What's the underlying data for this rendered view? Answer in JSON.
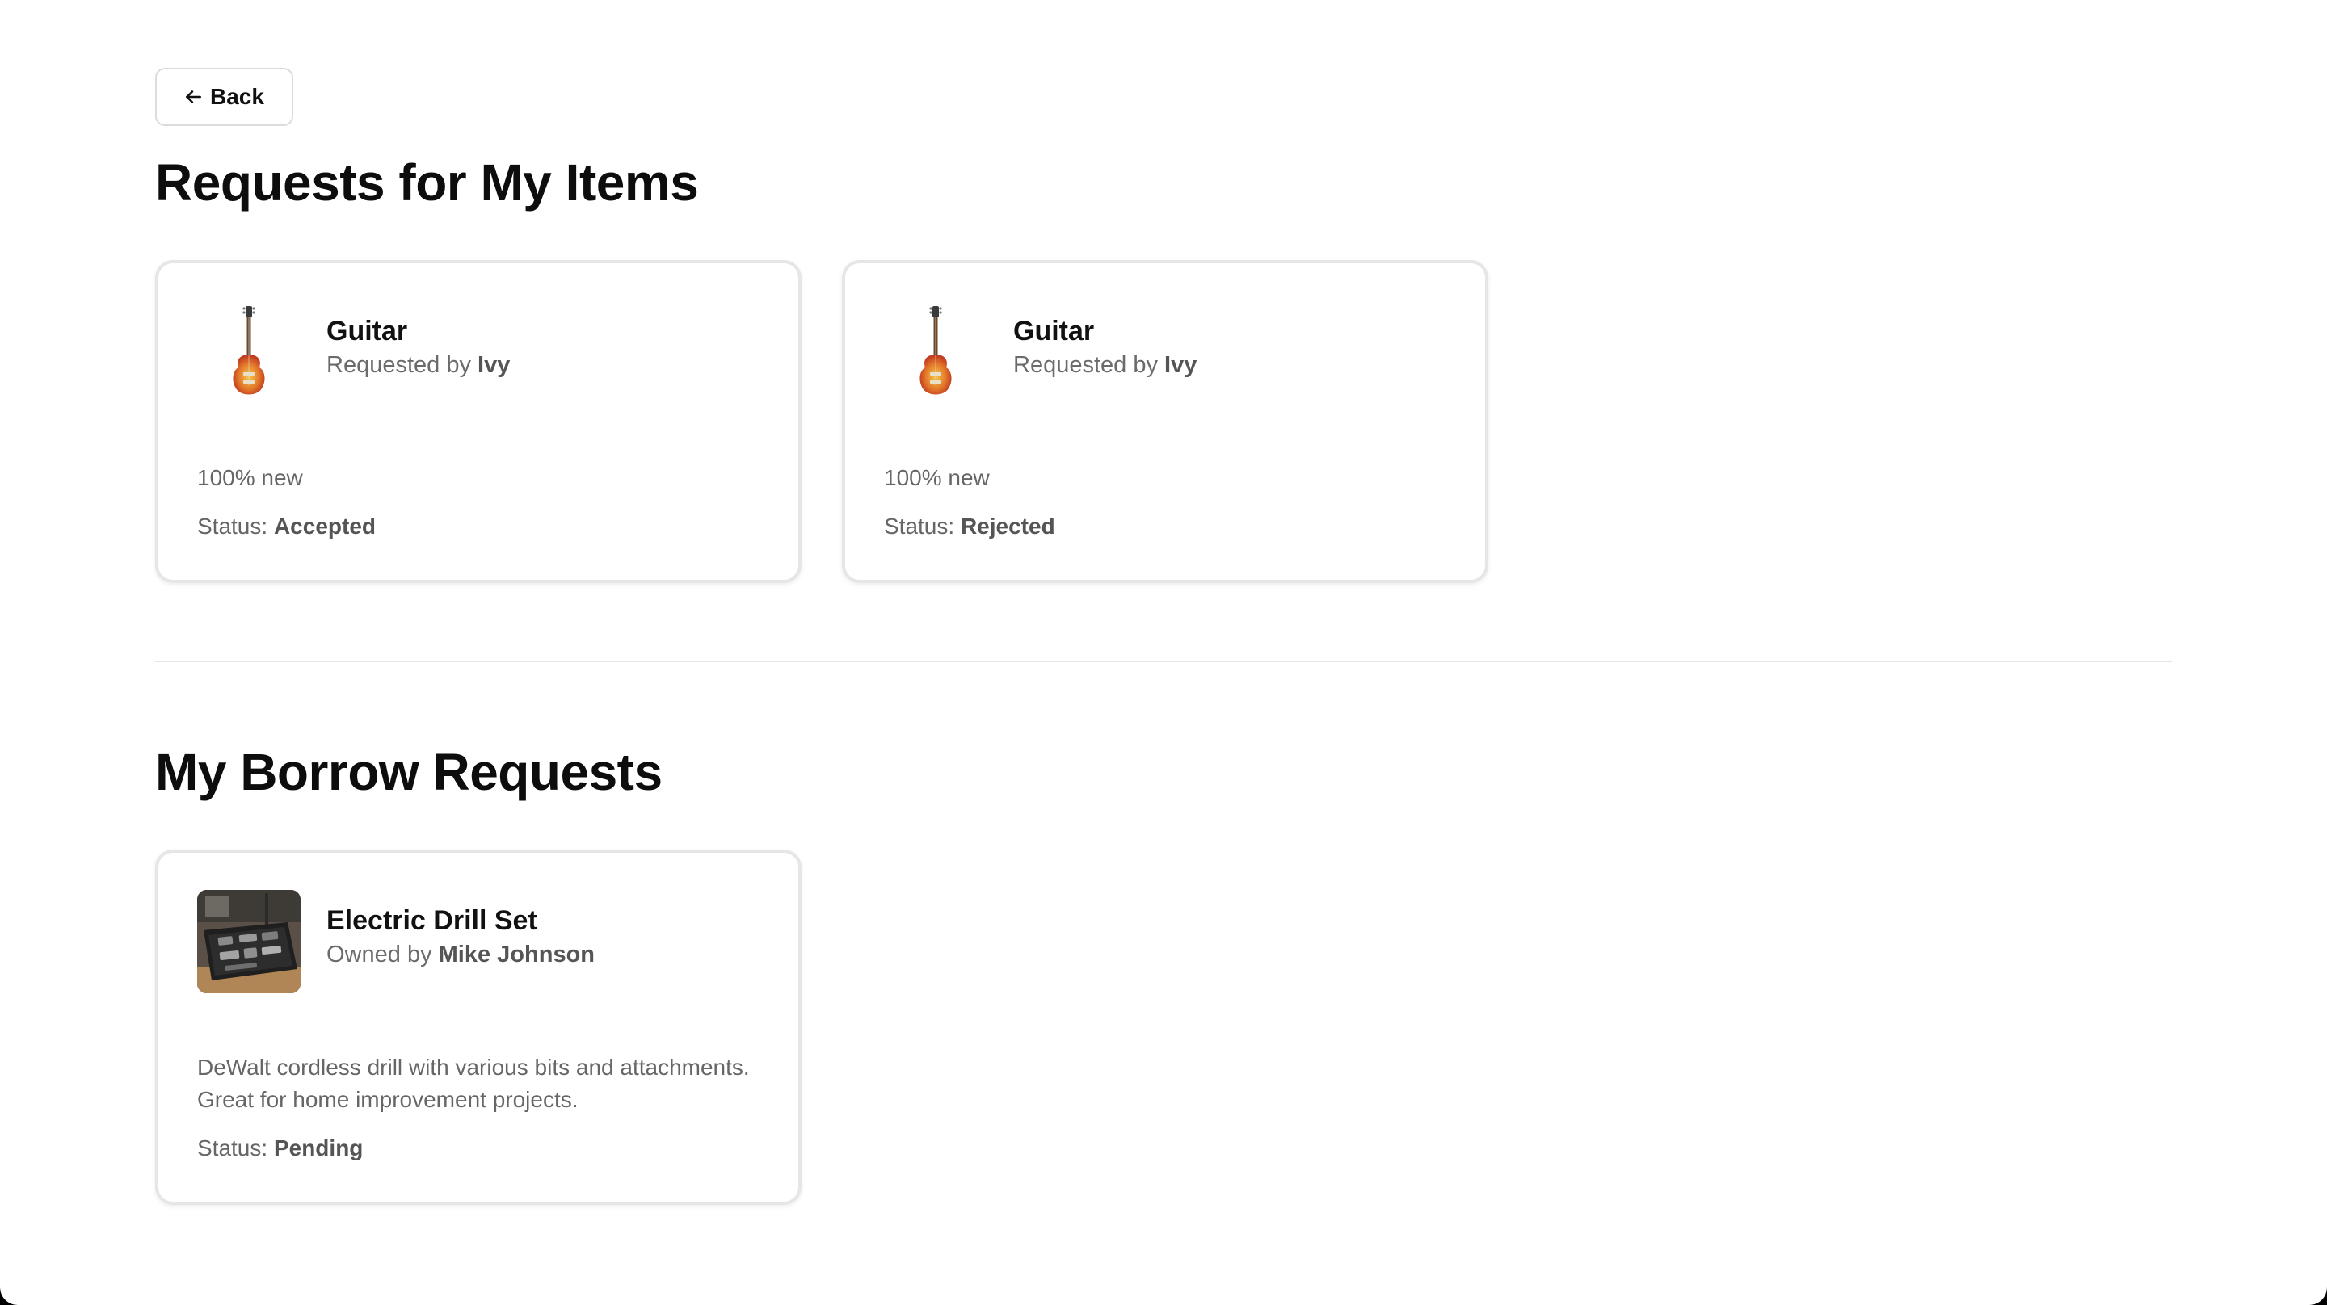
{
  "back_button": {
    "label": "Back"
  },
  "incoming": {
    "title": "Requests for My Items",
    "cards": [
      {
        "name": "Guitar",
        "sub_prefix": "Requested by",
        "person": "Ivy",
        "description": "100% new",
        "status_prefix": "Status:",
        "status": "Accepted",
        "icon": "guitar-icon"
      },
      {
        "name": "Guitar",
        "sub_prefix": "Requested by",
        "person": "Ivy",
        "description": "100% new",
        "status_prefix": "Status:",
        "status": "Rejected",
        "icon": "guitar-icon"
      }
    ]
  },
  "outgoing": {
    "title": "My Borrow Requests",
    "cards": [
      {
        "name": "Electric Drill Set",
        "sub_prefix": "Owned by",
        "person": "Mike Johnson",
        "description": "DeWalt cordless drill with various bits and attachments. Great for home improvement projects.",
        "status_prefix": "Status:",
        "status": "Pending",
        "icon": "drill-set-photo"
      }
    ]
  },
  "colors": {
    "heading": "#0d0d0d",
    "muted_text": "#6b6b6b",
    "card_border": "#e6e6e6",
    "divider": "#e5e5e5"
  }
}
